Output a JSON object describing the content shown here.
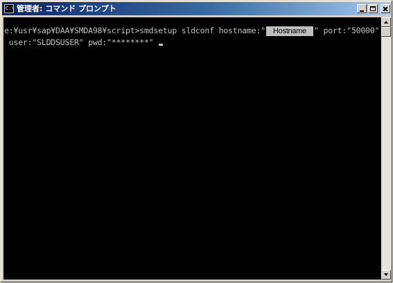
{
  "window": {
    "title": "管理者: コマンド プロンプト",
    "icon_label": "C:\\"
  },
  "console": {
    "line1_prefix": "e:¥usr¥sap¥DAA¥SMDA98¥script>smdsetup sldconf hostname:\"",
    "hostname_box": "Hostname",
    "line1_suffix": "\" port:\"50000\"",
    "line2": " user:\"SLDDSUSER\" pwd:\"********\""
  },
  "colors": {
    "console_bg": "#000000",
    "console_text": "#c0c0c0",
    "title_bar_start": "#0a246a"
  },
  "icons": [
    "command-prompt-icon",
    "minimize-icon",
    "maximize-icon",
    "close-icon",
    "scroll-up-icon",
    "scroll-down-icon"
  ]
}
